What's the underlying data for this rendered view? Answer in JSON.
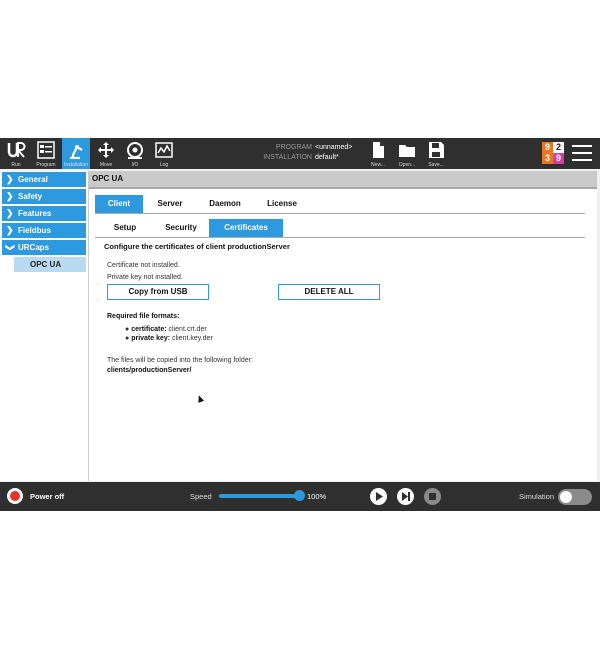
{
  "colors": {
    "accent": "#2d9ae0",
    "header_bg": "#2f2f2f",
    "power": "#e3342f"
  },
  "header": {
    "run_label": "Run",
    "program_label": "Program",
    "installation_label": "Installation",
    "move_label": "Move",
    "io_label": "I/O",
    "log_label": "Log",
    "program_key": "PROGRAM",
    "program_value": "<unnamed>",
    "installation_key": "INSTALLATION",
    "installation_value": "default*",
    "new_label": "New...",
    "open_label": "Open...",
    "save_label": "Save...",
    "counter": {
      "tl": "9",
      "tr": "2",
      "bl": "3",
      "br": "9"
    }
  },
  "sidebar": {
    "items": [
      {
        "label": "General"
      },
      {
        "label": "Safety"
      },
      {
        "label": "Features"
      },
      {
        "label": "Fieldbus"
      },
      {
        "label": "URCaps"
      }
    ],
    "subitem": "OPC UA"
  },
  "main": {
    "title": "OPC UA",
    "tabs": [
      "Client",
      "Server",
      "Daemon",
      "License"
    ],
    "subtabs": [
      "Setup",
      "Security",
      "Certificates"
    ],
    "heading": "Configure the certificates of client productionServer",
    "status1": "Certificate not installed.",
    "status2": "Private key not installed.",
    "copy_button": "Copy from USB",
    "delete_button": "DELETE ALL",
    "formats_heading": "Required file formats:",
    "cert_key": "certificate:",
    "cert_value": "client.crt.der",
    "pkey_key": "private key:",
    "pkey_value": "client.key.der",
    "folder_note": "The files will be copied into the following folder:",
    "folder_path": "clients/productionServer/"
  },
  "footer": {
    "power_label": "Power off",
    "speed_label": "Speed",
    "speed_value": "100%",
    "speed_fraction": 1.0,
    "simulation_label": "Simulation"
  }
}
